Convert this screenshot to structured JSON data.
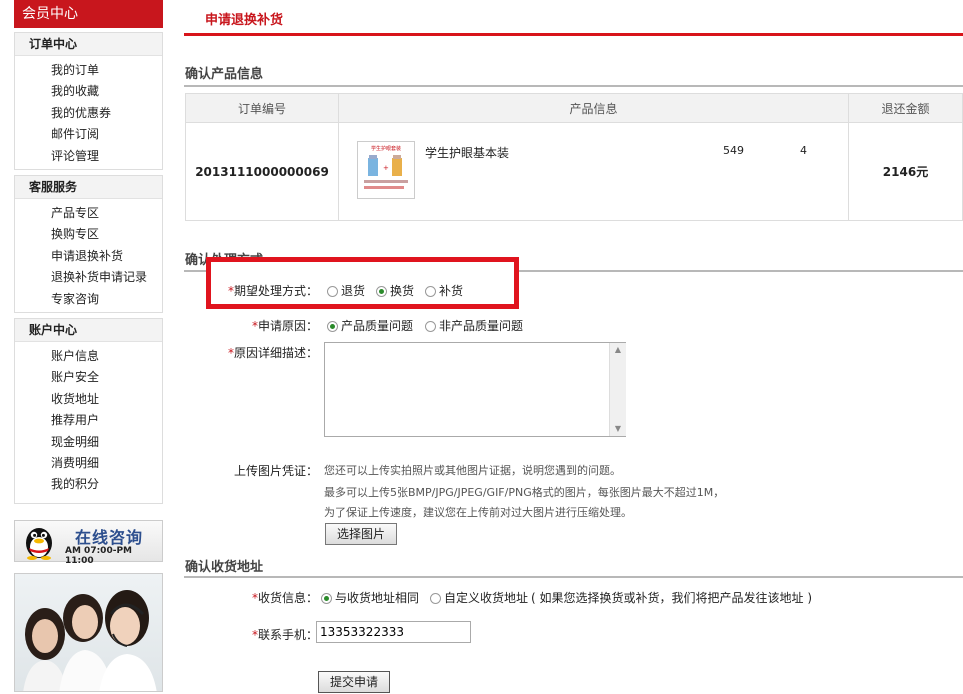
{
  "sidebar": {
    "title": "会员中心",
    "groups": [
      {
        "heading": "订单中心",
        "items": [
          "我的订单",
          "我的收藏",
          "我的优惠券",
          "邮件订阅",
          "评论管理"
        ]
      },
      {
        "heading": "客服服务",
        "items": [
          "产品专区",
          "换购专区",
          "申请退换补货",
          "退换补货申请记录",
          "专家咨询"
        ]
      },
      {
        "heading": "账户中心",
        "items": [
          "账户信息",
          "账户安全",
          "收货地址",
          "推荐用户",
          "现金明细",
          "消费明细",
          "我的积分"
        ]
      }
    ],
    "online": {
      "label": "在线咨询",
      "hours": "AM 07:00-PM 11:00"
    }
  },
  "page": {
    "title": "申请退换补货"
  },
  "product_section": {
    "title": "确认产品信息",
    "headers": [
      "订单编号",
      "产品信息",
      "退还金额"
    ],
    "row": {
      "order_no": "2013111000000069",
      "name": "学生护眼基本装",
      "price": "549",
      "qty": "4",
      "amount": "2146元",
      "thumb_text": "学生护眼套装"
    }
  },
  "process_section": {
    "title": "确认处理方式",
    "method_label": "期望处理方式：",
    "methods": [
      "退货",
      "换货",
      "补货"
    ],
    "method_selected": "换货",
    "reason_label": "申请原因：",
    "reasons": [
      "产品质量问题",
      "非产品质量问题"
    ],
    "reason_selected": "产品质量问题",
    "detail_label": "原因详细描述：",
    "detail_value": "",
    "upload_label": "上传图片凭证：",
    "upload_hints": [
      "您还可以上传实拍照片或其他图片证据，说明您遇到的问题。",
      "最多可以上传5张BMP/JPG/JPEG/GIF/PNG格式的图片，每张图片最大不超过1M，",
      "为了保证上传速度，建议您在上传前对过大图片进行压缩处理。"
    ],
    "upload_button": "选择图片"
  },
  "address_section": {
    "title": "确认收货地址",
    "ship_label": "收货信息：",
    "ship_options": [
      "与收货地址相同",
      "自定义收货地址"
    ],
    "ship_selected": "与收货地址相同",
    "ship_note": "( 如果您选择换货或补货，我们将把产品发往该地址 )",
    "phone_label": "联系手机：",
    "phone_value": "13353322333",
    "submit_label": "提交申请"
  },
  "colors": {
    "brand_red": "#c8161d",
    "highlight_box": "#e0141e",
    "radio_green": "#2a8a2a"
  }
}
